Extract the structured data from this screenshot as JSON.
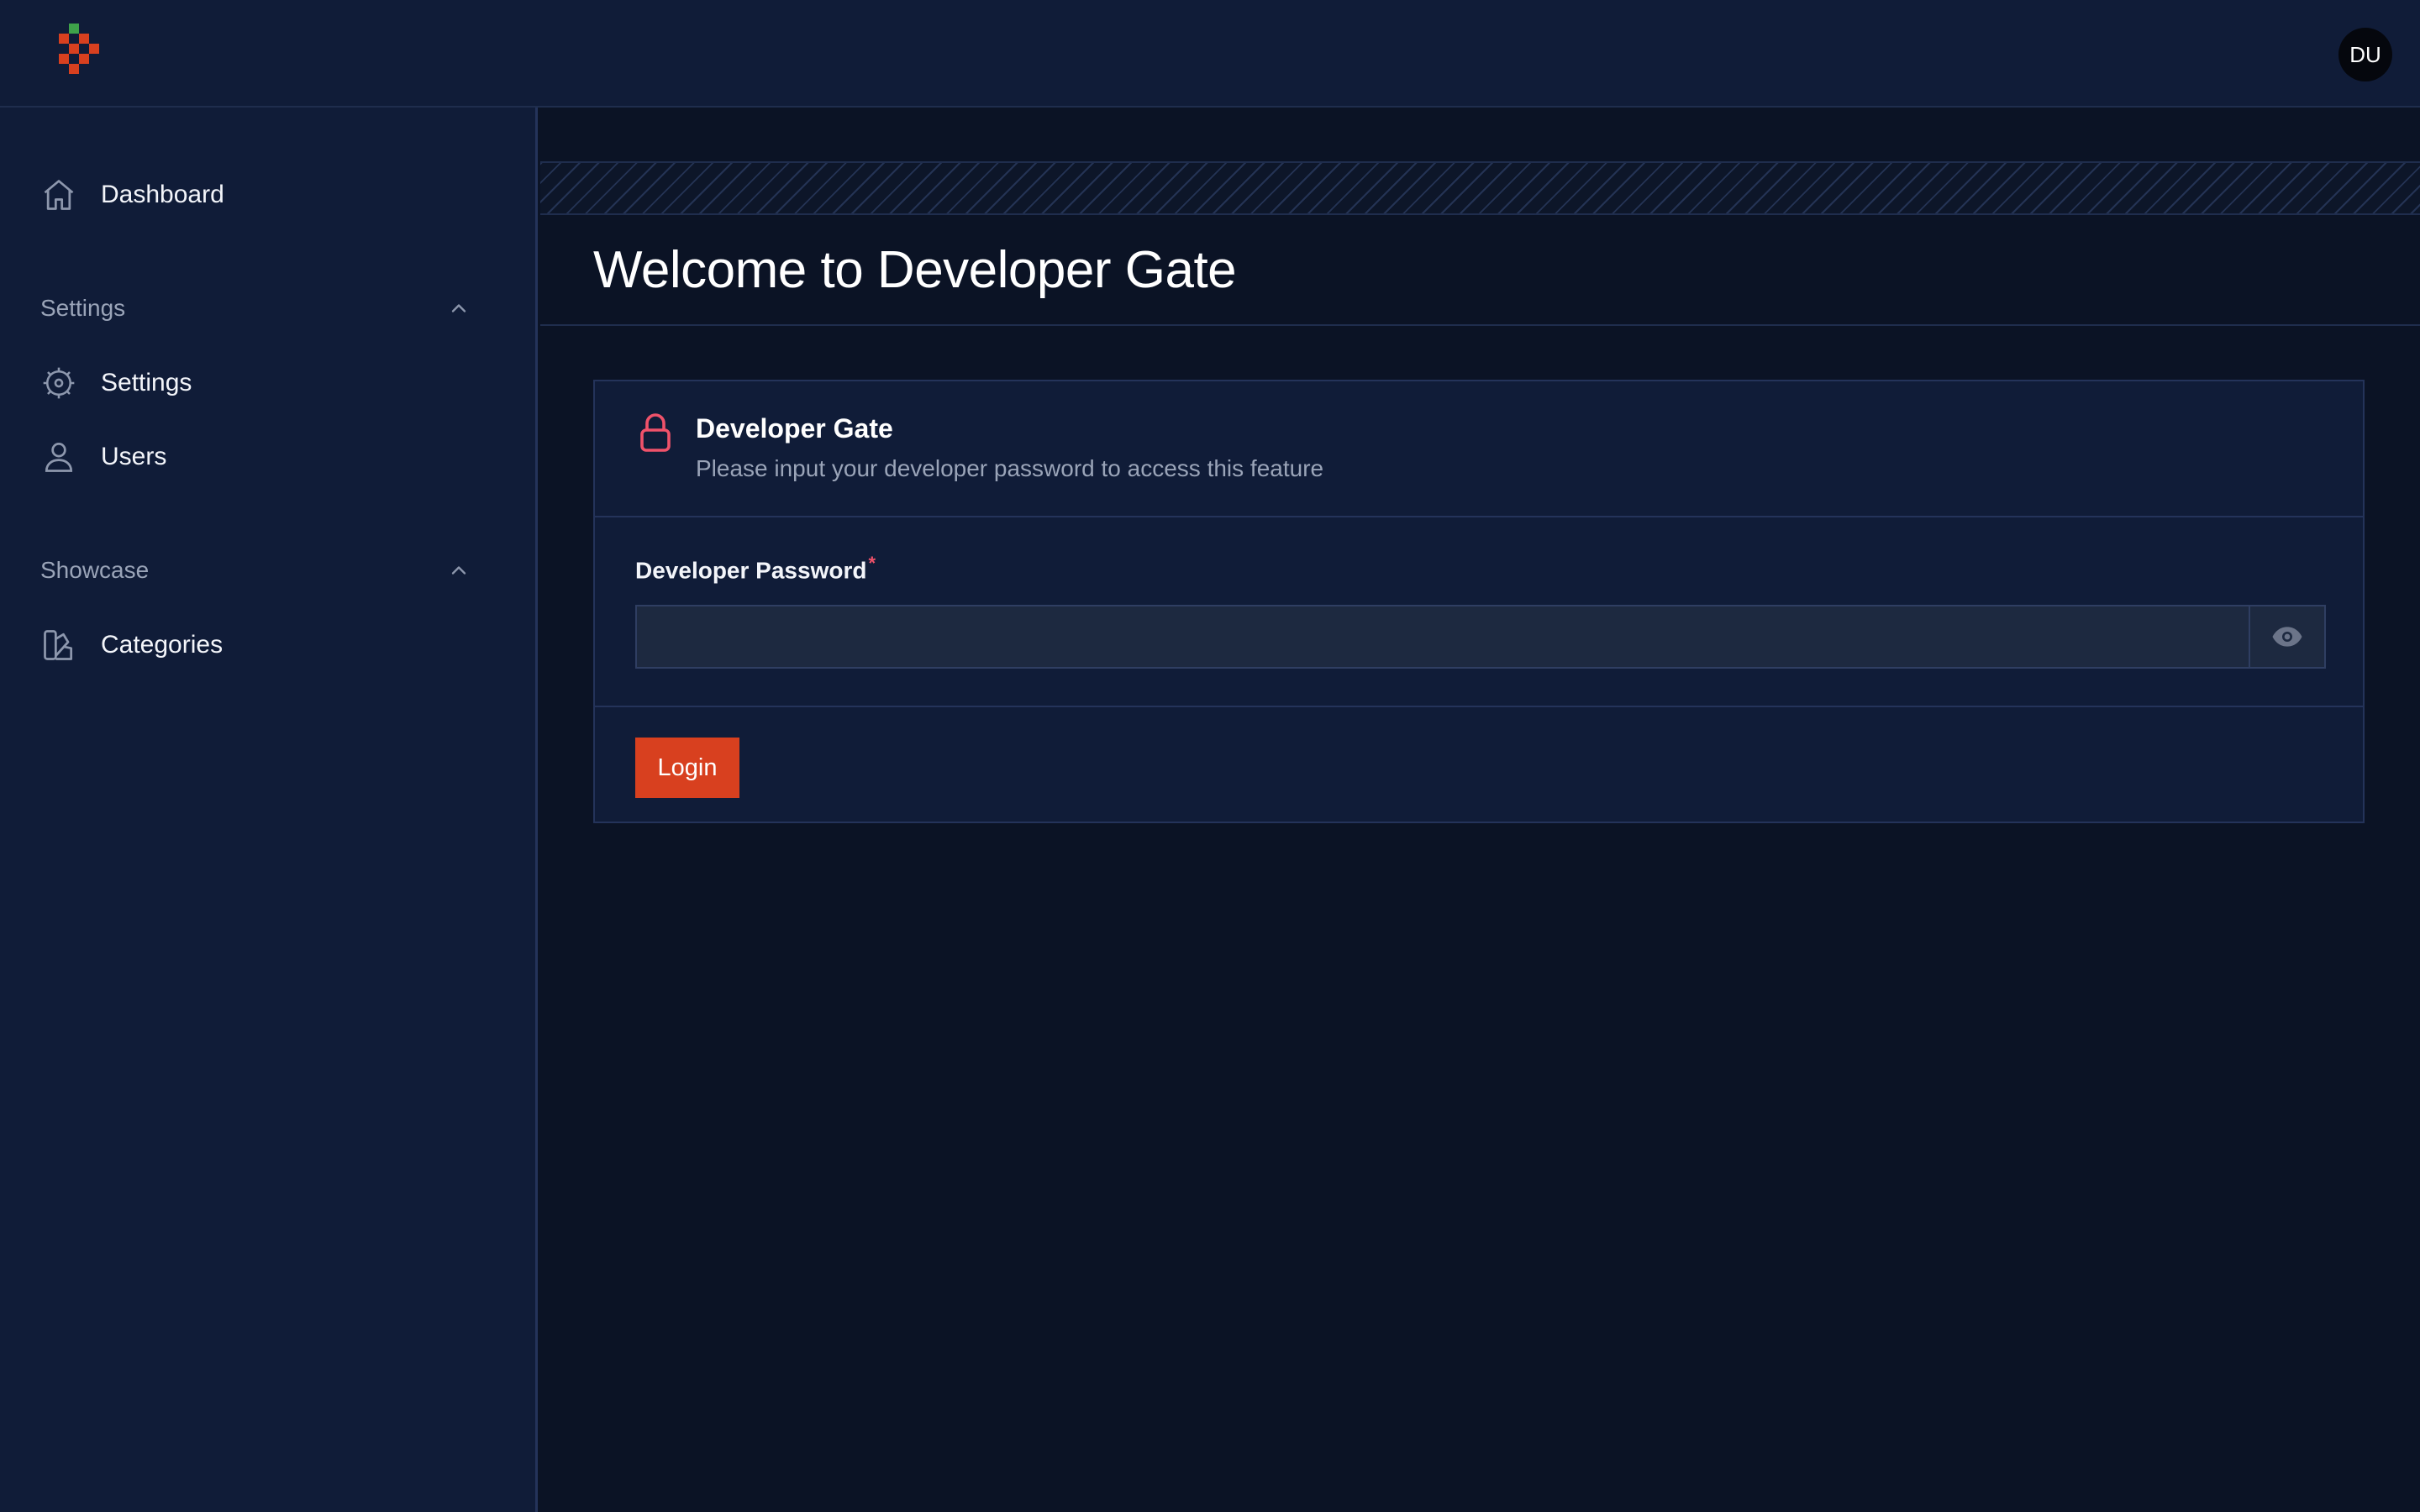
{
  "app": {
    "logo_icon": "checker-logo-icon",
    "avatar_initials": "DU"
  },
  "sidebar": {
    "dashboard": {
      "label": "Dashboard",
      "icon": "home-icon"
    },
    "groups": [
      {
        "label": "Settings",
        "icon": "chevron-up-icon",
        "items": [
          {
            "label": "Settings",
            "icon": "gear-icon"
          },
          {
            "label": "Users",
            "icon": "user-icon"
          }
        ]
      },
      {
        "label": "Showcase",
        "icon": "chevron-up-icon",
        "items": [
          {
            "label": "Categories",
            "icon": "swatch-icon"
          }
        ]
      }
    ]
  },
  "main": {
    "page_title": "Welcome to Developer Gate",
    "card": {
      "icon": "lock-icon",
      "title": "Developer Gate",
      "description": "Please input your developer password to access this feature",
      "field_label": "Developer Password",
      "required_marker": "*",
      "password_value": "",
      "password_placeholder": "",
      "toggle_icon": "eye-icon",
      "login_label": "Login"
    }
  },
  "colors": {
    "accent": "#d8401f",
    "lock_icon": "#f0526a",
    "sidebar_bg": "#101c38",
    "main_bg": "#0b1325"
  }
}
